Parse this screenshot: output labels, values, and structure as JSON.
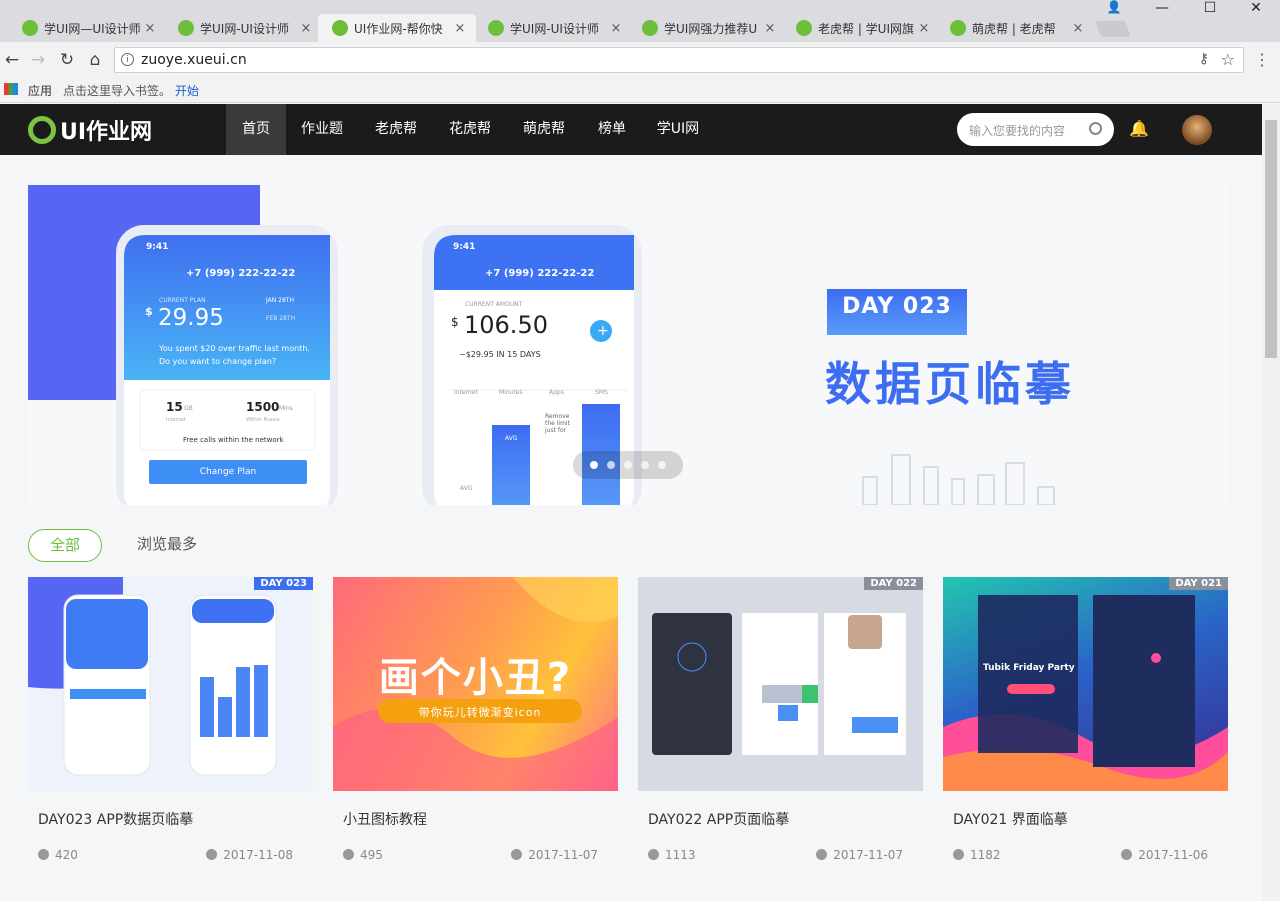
{
  "browser": {
    "tabs": [
      {
        "label": "学UI网—UI设计师"
      },
      {
        "label": "学UI网-UI设计师"
      },
      {
        "label": "UI作业网-帮你快"
      },
      {
        "label": "学UI网-UI设计师"
      },
      {
        "label": "学UI网强力推荐U"
      },
      {
        "label": "老虎帮 | 学UI网旗"
      },
      {
        "label": "萌虎帮 | 老虎帮"
      }
    ],
    "url": "zuoye.xueui.cn",
    "bookmarks": {
      "apps": "应用",
      "hint": "点击这里导入书签。",
      "start": "开始"
    }
  },
  "site": {
    "logo": "UI作业网",
    "nav": [
      {
        "label": "首页"
      },
      {
        "label": "作业题"
      },
      {
        "label": "老虎帮"
      },
      {
        "label": "花虎帮"
      },
      {
        "label": "萌虎帮"
      },
      {
        "label": "榜单"
      },
      {
        "label": "学UI网"
      }
    ],
    "search_placeholder": "输入您要找的内容"
  },
  "banner": {
    "day": "DAY 023",
    "title": "数据页临摹",
    "phone1": {
      "time": "9:41",
      "phone": "+7 (999) 222-22-22",
      "plan_label": "CURRENT PLAN",
      "amount": "29.95",
      "date1": "JAN 28TH",
      "date2": "FEB 28TH",
      "spent": "You spent $20 over traffic last month.",
      "question": "Do you want to change plan?",
      "gb": "15",
      "gb_unit": "GB",
      "mins": "1500",
      "mins_unit": "Mins",
      "gb_sub": "Internet",
      "mins_sub": "Within Russia",
      "calls": "Free calls within the network",
      "button": "Change Plan"
    },
    "phone2": {
      "time": "9:41",
      "phone": "+7 (999) 222-22-22",
      "amount_label": "CURRENT AMOUNT",
      "amount": "106.50",
      "sub": "−$29.95 IN 15 DAYS",
      "cols": [
        "Internet",
        "Minutes",
        "Apps",
        "SMS"
      ],
      "avg": "AVG",
      "remove": "Remove the limit just for"
    },
    "slides_total": 5,
    "slide_active": 1
  },
  "filters": {
    "all": "全部",
    "most": "浏览最多"
  },
  "cards": [
    {
      "title": "DAY023 APP数据页临摹",
      "views": "420",
      "date": "2017-11-08",
      "badge": "DAY 023"
    },
    {
      "title": "小丑图标教程",
      "views": "495",
      "date": "2017-11-07",
      "headline": "画个小丑?",
      "sub": "带你玩儿转微渐变icon"
    },
    {
      "title": "DAY022 APP页面临摹",
      "views": "1113",
      "date": "2017-11-07",
      "badge": "DAY 022"
    },
    {
      "title": "DAY021 界面临摹",
      "views": "1182",
      "date": "2017-11-06",
      "badge": "DAY 021",
      "event": "Tubik Friday Party"
    }
  ],
  "colors": {
    "green": "#6dbf3a",
    "blue": "#3d6ef1",
    "nav_bg": "#1b1b1b"
  }
}
